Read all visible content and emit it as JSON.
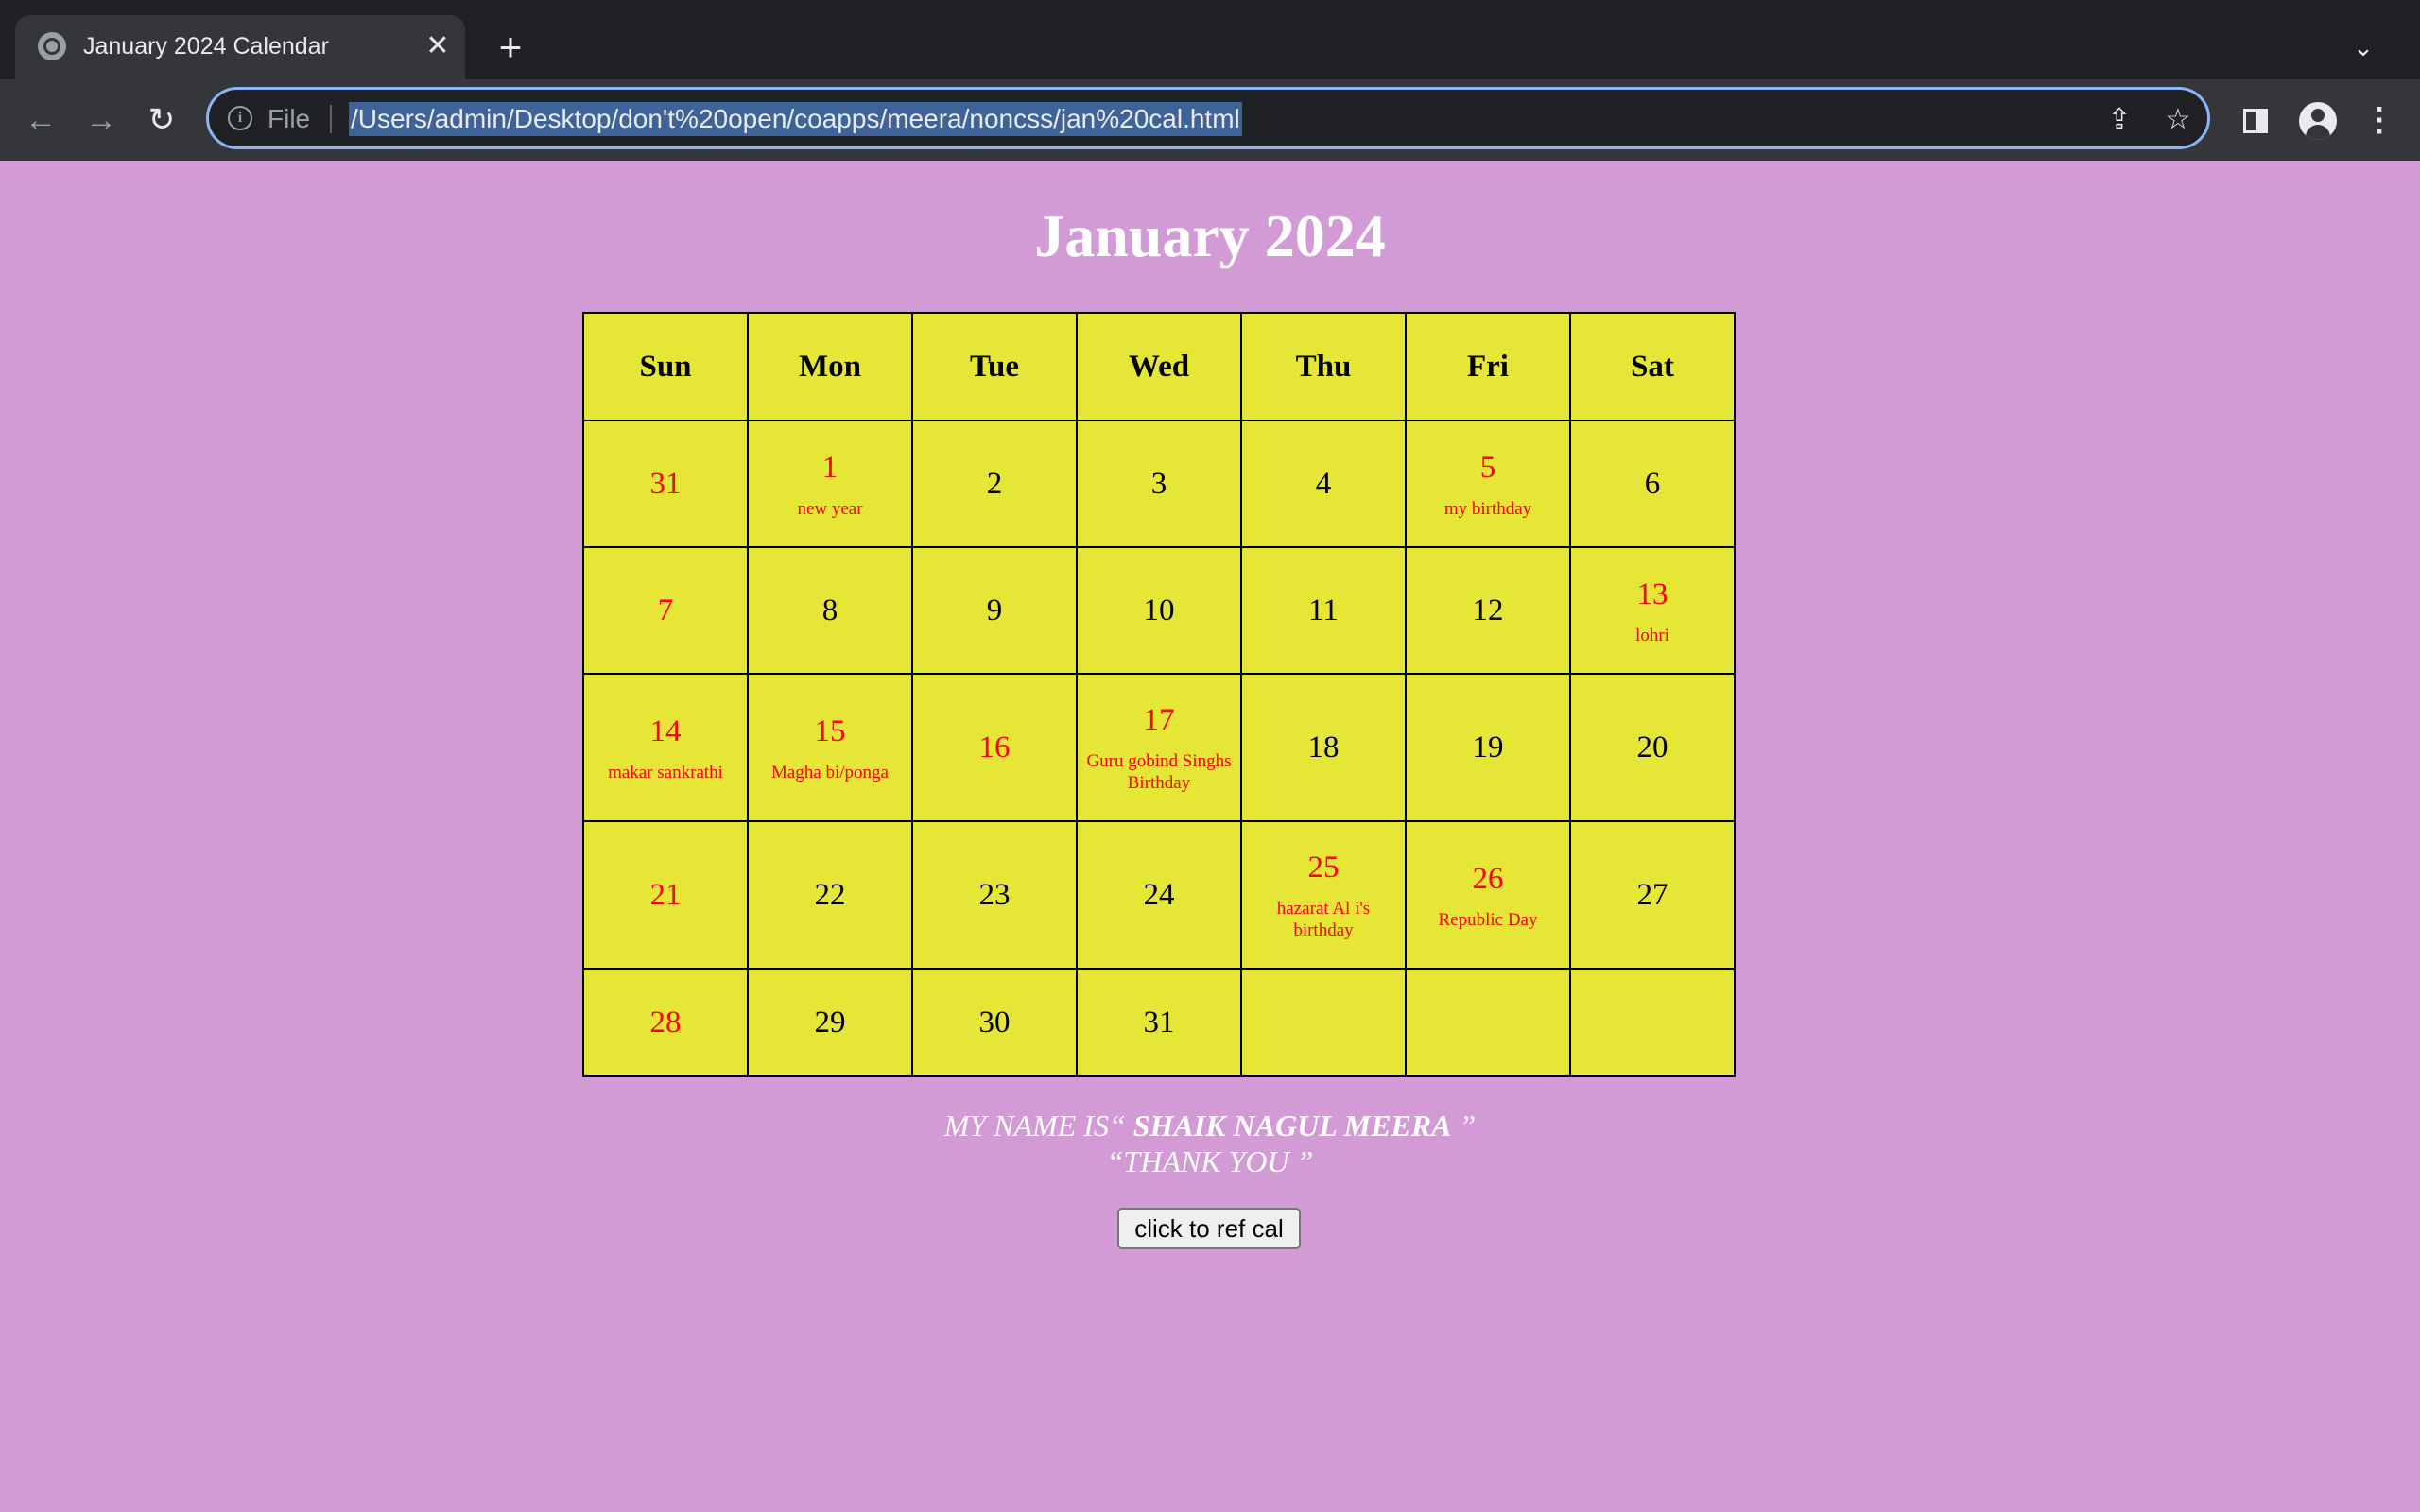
{
  "browser": {
    "tab_title": "January 2024 Calendar",
    "tab_close": "✕",
    "new_tab": "+",
    "tab_list": "⌄",
    "file_label": "File",
    "url": "/Users/admin/Desktop/don't%20open/coapps/meera/noncss/jan%20cal.html",
    "back": "←",
    "forward": "→",
    "reload": "↻",
    "share": "⇪",
    "bookmark": "☆",
    "menu": "⋮",
    "colors": {
      "tabbar": "#202124",
      "toolbar": "#35363a",
      "focus_ring": "#8ab4f8",
      "url_selection": "#3e6398"
    }
  },
  "page": {
    "title": "January 2024",
    "colors": {
      "background": "#d29bd6",
      "calendar_fill": "#e6e636",
      "holiday_text": "#ff0000"
    },
    "weekdays": [
      "Sun",
      "Mon",
      "Tue",
      "Wed",
      "Thu",
      "Fri",
      "Sat"
    ],
    "weeks": [
      [
        {
          "day": "31",
          "red": true,
          "note": ""
        },
        {
          "day": "1",
          "red": true,
          "note": "new year"
        },
        {
          "day": "2",
          "red": false,
          "note": ""
        },
        {
          "day": "3",
          "red": false,
          "note": ""
        },
        {
          "day": "4",
          "red": false,
          "note": ""
        },
        {
          "day": "5",
          "red": true,
          "note": "my birthday"
        },
        {
          "day": "6",
          "red": false,
          "note": ""
        }
      ],
      [
        {
          "day": "7",
          "red": true,
          "note": ""
        },
        {
          "day": "8",
          "red": false,
          "note": ""
        },
        {
          "day": "9",
          "red": false,
          "note": ""
        },
        {
          "day": "10",
          "red": false,
          "note": ""
        },
        {
          "day": "11",
          "red": false,
          "note": ""
        },
        {
          "day": "12",
          "red": false,
          "note": ""
        },
        {
          "day": "13",
          "red": true,
          "note": "lohri"
        }
      ],
      [
        {
          "day": "14",
          "red": true,
          "note": "makar sankrathi"
        },
        {
          "day": "15",
          "red": true,
          "note": "Magha bi/ponga"
        },
        {
          "day": "16",
          "red": true,
          "note": ""
        },
        {
          "day": "17",
          "red": true,
          "note": "Guru gobind Singhs Birthday"
        },
        {
          "day": "18",
          "red": false,
          "note": ""
        },
        {
          "day": "19",
          "red": false,
          "note": ""
        },
        {
          "day": "20",
          "red": false,
          "note": ""
        }
      ],
      [
        {
          "day": "21",
          "red": true,
          "note": ""
        },
        {
          "day": "22",
          "red": false,
          "note": ""
        },
        {
          "day": "23",
          "red": false,
          "note": ""
        },
        {
          "day": "24",
          "red": false,
          "note": ""
        },
        {
          "day": "25",
          "red": true,
          "note": "hazarat Al i's birthday"
        },
        {
          "day": "26",
          "red": true,
          "note": "Republic Day"
        },
        {
          "day": "27",
          "red": false,
          "note": ""
        }
      ],
      [
        {
          "day": "28",
          "red": true,
          "note": ""
        },
        {
          "day": "29",
          "red": false,
          "note": ""
        },
        {
          "day": "30",
          "red": false,
          "note": ""
        },
        {
          "day": "31",
          "red": false,
          "note": ""
        },
        {
          "day": "",
          "red": false,
          "note": ""
        },
        {
          "day": "",
          "red": false,
          "note": ""
        },
        {
          "day": "",
          "red": false,
          "note": ""
        }
      ]
    ],
    "name_prefix": "MY NAME IS“ ",
    "name": "SHAIK NAGUL MEERA",
    "name_suffix": " ”",
    "thanks": "“THANK YOU ”",
    "button_label": "click to ref cal"
  }
}
